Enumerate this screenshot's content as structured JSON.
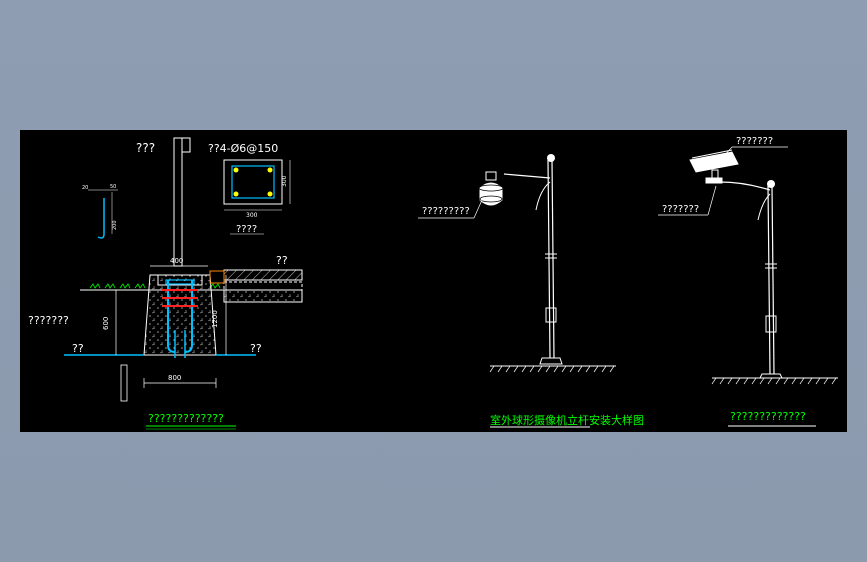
{
  "drawing": {
    "foundation": {
      "pole_label": "???",
      "rebar_spec": "??4-Ø6@150",
      "section_width": "300",
      "section_height": "300",
      "section_note": "????",
      "right_note": "??",
      "left_note": "???????",
      "bottom_left_note": "??",
      "bottom_right_note": "??",
      "top_width": "400",
      "depth": "600",
      "base_width": "800",
      "total_height": "1200",
      "hook_dim_1": "20",
      "hook_dim_2": "50",
      "hook_dim_3": "200",
      "title": "?????????????"
    },
    "dome_pole": {
      "camera_label": "?????????",
      "title": "室外球形摄像机立杆安装大样图"
    },
    "box_pole": {
      "camera_label": "???????",
      "bracket_label": "???????",
      "title": "?????????????"
    }
  },
  "colors": {
    "background": "#8e9cb0",
    "canvas": "#000000",
    "lines": "#ffffff",
    "accent_green": "#00ff00",
    "rebar_blue": "#00bfff",
    "rebar_red": "#ff2020",
    "anchor_yellow": "#ffff00"
  }
}
